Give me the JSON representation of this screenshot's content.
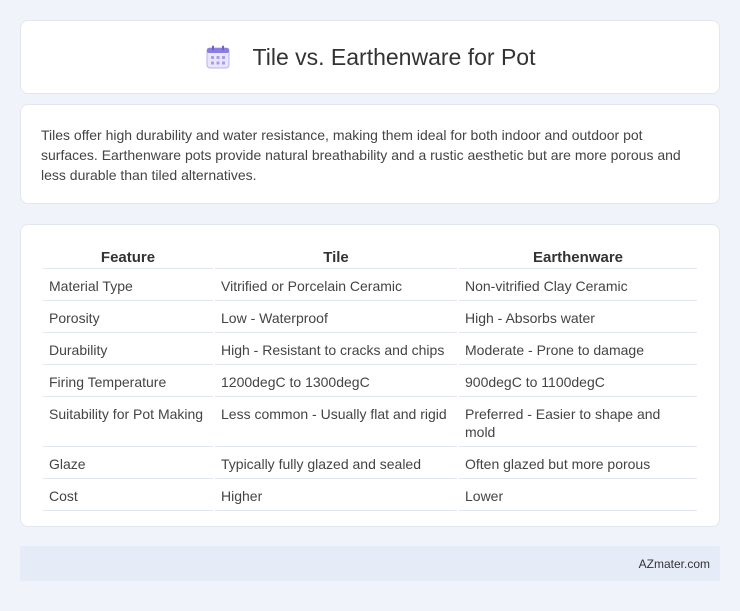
{
  "header": {
    "title": "Tile vs. Earthenware for Pot",
    "icon": "calendar-icon"
  },
  "intro": {
    "text": "Tiles offer high durability and water resistance, making them ideal for both indoor and outdoor pot surfaces. Earthenware pots provide natural breathability and a rustic aesthetic but are more porous and less durable than tiled alternatives."
  },
  "table": {
    "headers": [
      "Feature",
      "Tile",
      "Earthenware"
    ],
    "rows": [
      [
        "Material Type",
        "Vitrified or Porcelain Ceramic",
        "Non-vitrified Clay Ceramic"
      ],
      [
        "Porosity",
        "Low - Waterproof",
        "High - Absorbs water"
      ],
      [
        "Durability",
        "High - Resistant to cracks and chips",
        "Moderate - Prone to damage"
      ],
      [
        "Firing Temperature",
        "1200degC to 1300degC",
        "900degC to 1100degC"
      ],
      [
        "Suitability for Pot Making",
        "Less common - Usually flat and rigid",
        "Preferred - Easier to shape and mold"
      ],
      [
        "Glaze",
        "Typically fully glazed and sealed",
        "Often glazed but more porous"
      ],
      [
        "Cost",
        "Higher",
        "Lower"
      ]
    ]
  },
  "footer": {
    "brand": "AZmater.com"
  },
  "colors": {
    "background": "#f0f3f9",
    "card": "#ffffff",
    "footer": "#e6ecf7",
    "icon_accent": "#8a7fe0"
  }
}
